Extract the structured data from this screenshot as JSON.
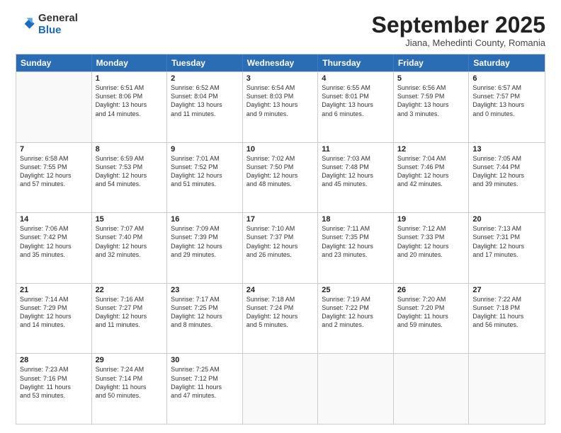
{
  "logo": {
    "general": "General",
    "blue": "Blue"
  },
  "title": "September 2025",
  "subtitle": "Jiana, Mehedinti County, Romania",
  "headers": [
    "Sunday",
    "Monday",
    "Tuesday",
    "Wednesday",
    "Thursday",
    "Friday",
    "Saturday"
  ],
  "weeks": [
    [
      {
        "date": "",
        "info": ""
      },
      {
        "date": "1",
        "info": "Sunrise: 6:51 AM\nSunset: 8:06 PM\nDaylight: 13 hours\nand 14 minutes."
      },
      {
        "date": "2",
        "info": "Sunrise: 6:52 AM\nSunset: 8:04 PM\nDaylight: 13 hours\nand 11 minutes."
      },
      {
        "date": "3",
        "info": "Sunrise: 6:54 AM\nSunset: 8:03 PM\nDaylight: 13 hours\nand 9 minutes."
      },
      {
        "date": "4",
        "info": "Sunrise: 6:55 AM\nSunset: 8:01 PM\nDaylight: 13 hours\nand 6 minutes."
      },
      {
        "date": "5",
        "info": "Sunrise: 6:56 AM\nSunset: 7:59 PM\nDaylight: 13 hours\nand 3 minutes."
      },
      {
        "date": "6",
        "info": "Sunrise: 6:57 AM\nSunset: 7:57 PM\nDaylight: 13 hours\nand 0 minutes."
      }
    ],
    [
      {
        "date": "7",
        "info": "Sunrise: 6:58 AM\nSunset: 7:55 PM\nDaylight: 12 hours\nand 57 minutes."
      },
      {
        "date": "8",
        "info": "Sunrise: 6:59 AM\nSunset: 7:53 PM\nDaylight: 12 hours\nand 54 minutes."
      },
      {
        "date": "9",
        "info": "Sunrise: 7:01 AM\nSunset: 7:52 PM\nDaylight: 12 hours\nand 51 minutes."
      },
      {
        "date": "10",
        "info": "Sunrise: 7:02 AM\nSunset: 7:50 PM\nDaylight: 12 hours\nand 48 minutes."
      },
      {
        "date": "11",
        "info": "Sunrise: 7:03 AM\nSunset: 7:48 PM\nDaylight: 12 hours\nand 45 minutes."
      },
      {
        "date": "12",
        "info": "Sunrise: 7:04 AM\nSunset: 7:46 PM\nDaylight: 12 hours\nand 42 minutes."
      },
      {
        "date": "13",
        "info": "Sunrise: 7:05 AM\nSunset: 7:44 PM\nDaylight: 12 hours\nand 39 minutes."
      }
    ],
    [
      {
        "date": "14",
        "info": "Sunrise: 7:06 AM\nSunset: 7:42 PM\nDaylight: 12 hours\nand 35 minutes."
      },
      {
        "date": "15",
        "info": "Sunrise: 7:07 AM\nSunset: 7:40 PM\nDaylight: 12 hours\nand 32 minutes."
      },
      {
        "date": "16",
        "info": "Sunrise: 7:09 AM\nSunset: 7:39 PM\nDaylight: 12 hours\nand 29 minutes."
      },
      {
        "date": "17",
        "info": "Sunrise: 7:10 AM\nSunset: 7:37 PM\nDaylight: 12 hours\nand 26 minutes."
      },
      {
        "date": "18",
        "info": "Sunrise: 7:11 AM\nSunset: 7:35 PM\nDaylight: 12 hours\nand 23 minutes."
      },
      {
        "date": "19",
        "info": "Sunrise: 7:12 AM\nSunset: 7:33 PM\nDaylight: 12 hours\nand 20 minutes."
      },
      {
        "date": "20",
        "info": "Sunrise: 7:13 AM\nSunset: 7:31 PM\nDaylight: 12 hours\nand 17 minutes."
      }
    ],
    [
      {
        "date": "21",
        "info": "Sunrise: 7:14 AM\nSunset: 7:29 PM\nDaylight: 12 hours\nand 14 minutes."
      },
      {
        "date": "22",
        "info": "Sunrise: 7:16 AM\nSunset: 7:27 PM\nDaylight: 12 hours\nand 11 minutes."
      },
      {
        "date": "23",
        "info": "Sunrise: 7:17 AM\nSunset: 7:25 PM\nDaylight: 12 hours\nand 8 minutes."
      },
      {
        "date": "24",
        "info": "Sunrise: 7:18 AM\nSunset: 7:24 PM\nDaylight: 12 hours\nand 5 minutes."
      },
      {
        "date": "25",
        "info": "Sunrise: 7:19 AM\nSunset: 7:22 PM\nDaylight: 12 hours\nand 2 minutes."
      },
      {
        "date": "26",
        "info": "Sunrise: 7:20 AM\nSunset: 7:20 PM\nDaylight: 11 hours\nand 59 minutes."
      },
      {
        "date": "27",
        "info": "Sunrise: 7:22 AM\nSunset: 7:18 PM\nDaylight: 11 hours\nand 56 minutes."
      }
    ],
    [
      {
        "date": "28",
        "info": "Sunrise: 7:23 AM\nSunset: 7:16 PM\nDaylight: 11 hours\nand 53 minutes."
      },
      {
        "date": "29",
        "info": "Sunrise: 7:24 AM\nSunset: 7:14 PM\nDaylight: 11 hours\nand 50 minutes."
      },
      {
        "date": "30",
        "info": "Sunrise: 7:25 AM\nSunset: 7:12 PM\nDaylight: 11 hours\nand 47 minutes."
      },
      {
        "date": "",
        "info": ""
      },
      {
        "date": "",
        "info": ""
      },
      {
        "date": "",
        "info": ""
      },
      {
        "date": "",
        "info": ""
      }
    ]
  ]
}
